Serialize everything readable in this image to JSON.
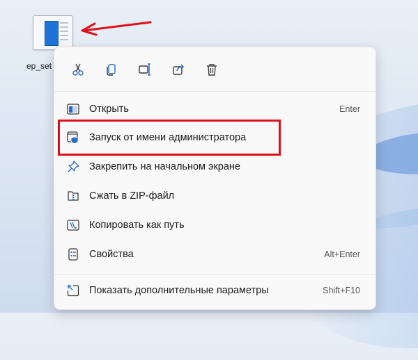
{
  "desktop": {
    "icon_label": "ep_set",
    "icon_name": "executable-file-icon"
  },
  "annotation": {
    "arrow_color": "#e00e18",
    "highlight_color": "#e00e18"
  },
  "toolbar": [
    {
      "name": "cut",
      "icon": "scissors-icon"
    },
    {
      "name": "copy",
      "icon": "copy-icon"
    },
    {
      "name": "rename",
      "icon": "rename-icon"
    },
    {
      "name": "share",
      "icon": "share-icon"
    },
    {
      "name": "delete",
      "icon": "trash-icon"
    }
  ],
  "menu": {
    "open": {
      "label": "Открыть",
      "shortcut": "Enter",
      "icon": "window-icon"
    },
    "run_as_admin": {
      "label": "Запуск от имени администратора",
      "icon": "shield-icon"
    },
    "pin_start": {
      "label": "Закрепить на начальном экране",
      "icon": "pin-icon"
    },
    "zip": {
      "label": "Сжать в ZIP-файл",
      "icon": "zip-icon"
    },
    "copy_path": {
      "label": "Копировать как путь",
      "icon": "path-icon"
    },
    "properties": {
      "label": "Свойства",
      "shortcut": "Alt+Enter",
      "icon": "properties-icon"
    },
    "more_options": {
      "label": "Показать дополнительные параметры",
      "shortcut": "Shift+F10",
      "icon": "more-options-icon"
    }
  },
  "colors": {
    "accent": "#1f72d6",
    "icon_blue": "#2b6cc4"
  }
}
